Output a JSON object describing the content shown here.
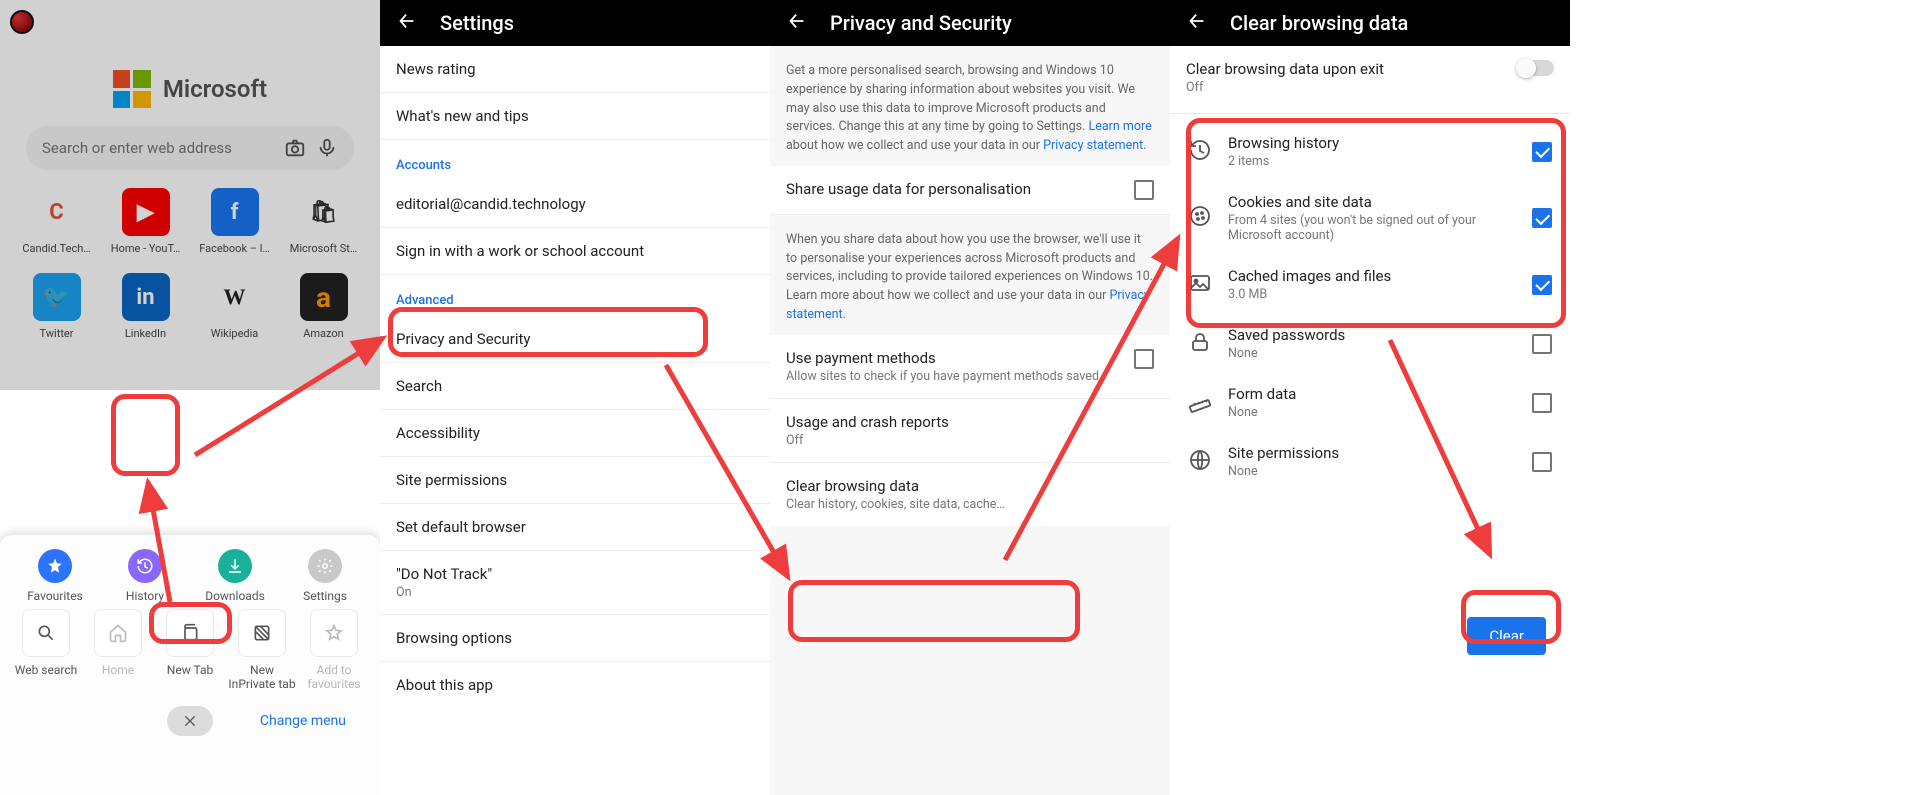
{
  "panel1": {
    "brand": "Microsoft",
    "search_placeholder": "Search or enter web address",
    "favorites_row1": [
      {
        "label": "Candid.Tech…",
        "glyph": "C",
        "cls": "candid",
        "color": "#e2513f"
      },
      {
        "label": "Home - YouT…",
        "glyph": "▶",
        "cls": "yt"
      },
      {
        "label": "Facebook – l…",
        "glyph": "f",
        "cls": "fb"
      },
      {
        "label": "Microsoft St…",
        "glyph": "🛍",
        "cls": "store",
        "color": "#333"
      }
    ],
    "favorites_row2": [
      {
        "label": "Twitter",
        "glyph": "🐦",
        "cls": "tw"
      },
      {
        "label": "LinkedIn",
        "glyph": "in",
        "cls": "li"
      },
      {
        "label": "Wikipedia",
        "glyph": "W",
        "cls": "wiki"
      },
      {
        "label": "Amazon",
        "glyph": "a",
        "cls": "amz"
      }
    ],
    "sheet_top": [
      {
        "label": "Favourites",
        "cls": "c-blue",
        "icon": "star"
      },
      {
        "label": "History",
        "cls": "c-purple",
        "icon": "history"
      },
      {
        "label": "Downloads",
        "cls": "c-teal",
        "icon": "download"
      },
      {
        "label": "Settings",
        "cls": "c-grey",
        "icon": "gear"
      }
    ],
    "sheet_bottom": [
      {
        "label": "Web search",
        "icon": "search",
        "enabled": true
      },
      {
        "label": "Home",
        "icon": "home",
        "enabled": false
      },
      {
        "label": "New Tab",
        "icon": "tabs",
        "enabled": true
      },
      {
        "label": "New InPrivate tab",
        "icon": "inprivate",
        "enabled": true
      },
      {
        "label": "Add to favourites",
        "icon": "star-outline",
        "enabled": false
      }
    ],
    "change_menu": "Change menu"
  },
  "panel2": {
    "title": "Settings",
    "items": {
      "news_rating": "News rating",
      "whats_new": "What's new and tips",
      "section_accounts": "Accounts",
      "email": "editorial@candid.technology",
      "signin_work": "Sign in with a work or school account",
      "section_advanced": "Advanced",
      "privacy": "Privacy and Security",
      "search": "Search",
      "accessibility": "Accessibility",
      "site_permissions": "Site permissions",
      "default_browser": "Set default browser",
      "do_not_track": "\"Do Not Track\"",
      "dnt_state": "On",
      "browsing_options": "Browsing options",
      "about": "About this app"
    }
  },
  "panel3": {
    "title": "Privacy and Security",
    "info1": "Get a more personalised search, browsing and Windows 10 experience by sharing information about websites you visit. We may also use this data to improve Microsoft products and services. Change this at any time by going to Settings. ",
    "learn_more": "Learn more",
    "info1b": " about how we collect and use your data in our ",
    "privacy_statement": "Privacy statement",
    "share_usage": "Share usage data for personalisation",
    "info2": "When you share data about how you use the browser, we'll use it to personalise your experiences across Microsoft products and services, including to provide tailored experiences on Windows 10. Learn more about how we collect and use your data in our ",
    "use_payment": "Use payment methods",
    "use_payment_sub": "Allow sites to check if you have payment methods saved",
    "usage_crash": "Usage and crash reports",
    "usage_crash_state": "Off",
    "clear_browsing": "Clear browsing data",
    "clear_browsing_sub": "Clear history, cookies, site data, cache…"
  },
  "panel4": {
    "title": "Clear browsing data",
    "upon_exit": "Clear browsing data upon exit",
    "upon_exit_state": "Off",
    "items": [
      {
        "title": "Browsing history",
        "sub": "2 items",
        "icon": "history",
        "checked": true
      },
      {
        "title": "Cookies and site data",
        "sub": "From 4 sites (you won't be signed out of your Microsoft account)",
        "icon": "cookie",
        "checked": true
      },
      {
        "title": "Cached images and files",
        "sub": "3.0 MB",
        "icon": "image",
        "checked": true
      },
      {
        "title": "Saved passwords",
        "sub": "None",
        "icon": "lock",
        "checked": false
      },
      {
        "title": "Form data",
        "sub": "None",
        "icon": "ruler",
        "checked": false
      },
      {
        "title": "Site permissions",
        "sub": "None",
        "icon": "globe",
        "checked": false
      }
    ],
    "clear_button": "Clear"
  }
}
